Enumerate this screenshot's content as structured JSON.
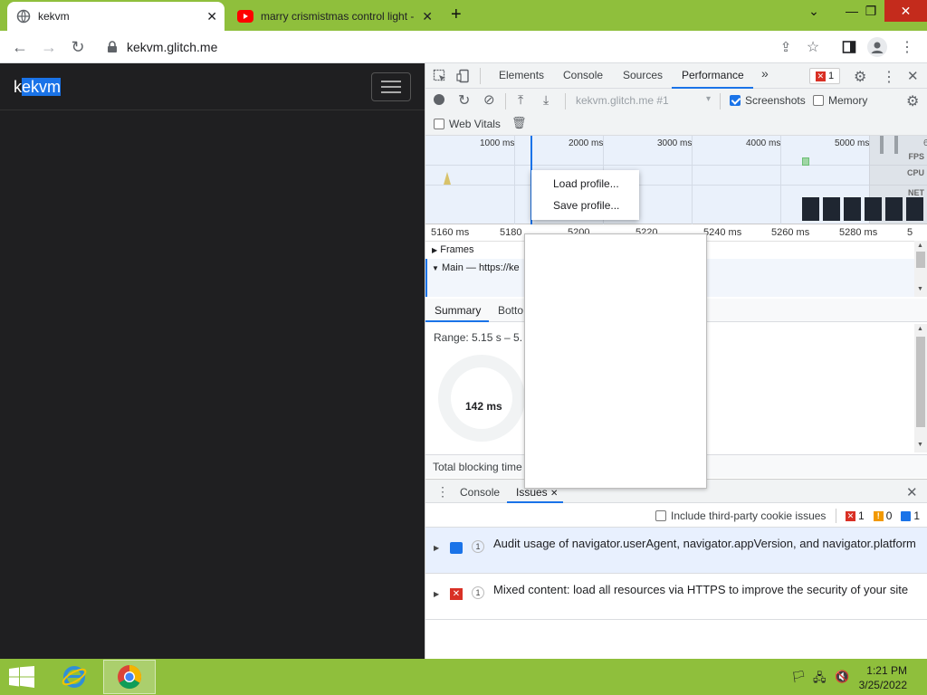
{
  "browser": {
    "tabs": [
      {
        "title": "kekvm"
      },
      {
        "title": "marry crismistmas control light -"
      }
    ],
    "new_tab": "+",
    "address": "kekvm.glitch.me"
  },
  "page": {
    "brand_pre": "k",
    "brand_sel": "ekvm"
  },
  "devtools": {
    "tabs": [
      "Elements",
      "Console",
      "Sources",
      "Performance"
    ],
    "more": "»",
    "error_count": "1",
    "profile_select": "kekvm.glitch.me #1",
    "screenshots_label": "Screenshots",
    "memory_label": "Memory",
    "web_vitals_label": "Web Vitals",
    "overview_ticks": [
      "1000 ms",
      "2000 ms",
      "3000 ms",
      "4000 ms",
      "5000 ms",
      "6"
    ],
    "overview_labels": [
      "FPS",
      "CPU",
      "NET"
    ],
    "detail_ticks": [
      "5160 ms",
      "5180",
      "5200",
      "5220",
      "5240 ms",
      "5260 ms",
      "5280 ms",
      "5"
    ],
    "frames_label": "Frames",
    "main_label": "Main — https://ke",
    "summary_tabs": [
      "Summary",
      "Botto"
    ],
    "range_text": "Range: 5.15 s – 5.",
    "donut_value": "142 ms",
    "tbt_text": "Total blocking time",
    "context_menu": [
      "Load profile...",
      "Save profile..."
    ]
  },
  "drawer": {
    "tabs": [
      "Console",
      "Issues"
    ],
    "include_third_party": "Include third-party cookie issues",
    "counts": {
      "errors": "1",
      "warnings": "0",
      "info": "1"
    },
    "issues": [
      {
        "count": "1",
        "text": "Audit usage of navigator.userAgent, navigator.appVersion, and navigator.platform",
        "kind": "info"
      },
      {
        "count": "1",
        "text": "Mixed content: load all resources via HTTPS to improve the security of your site",
        "kind": "error"
      }
    ]
  },
  "taskbar": {
    "time": "1:21 PM",
    "date": "3/25/2022"
  },
  "colors": {
    "accent": "#1a73e8",
    "titlebar": "#8fbf3c",
    "page_bg": "#1f1f21",
    "error": "#d93025"
  }
}
